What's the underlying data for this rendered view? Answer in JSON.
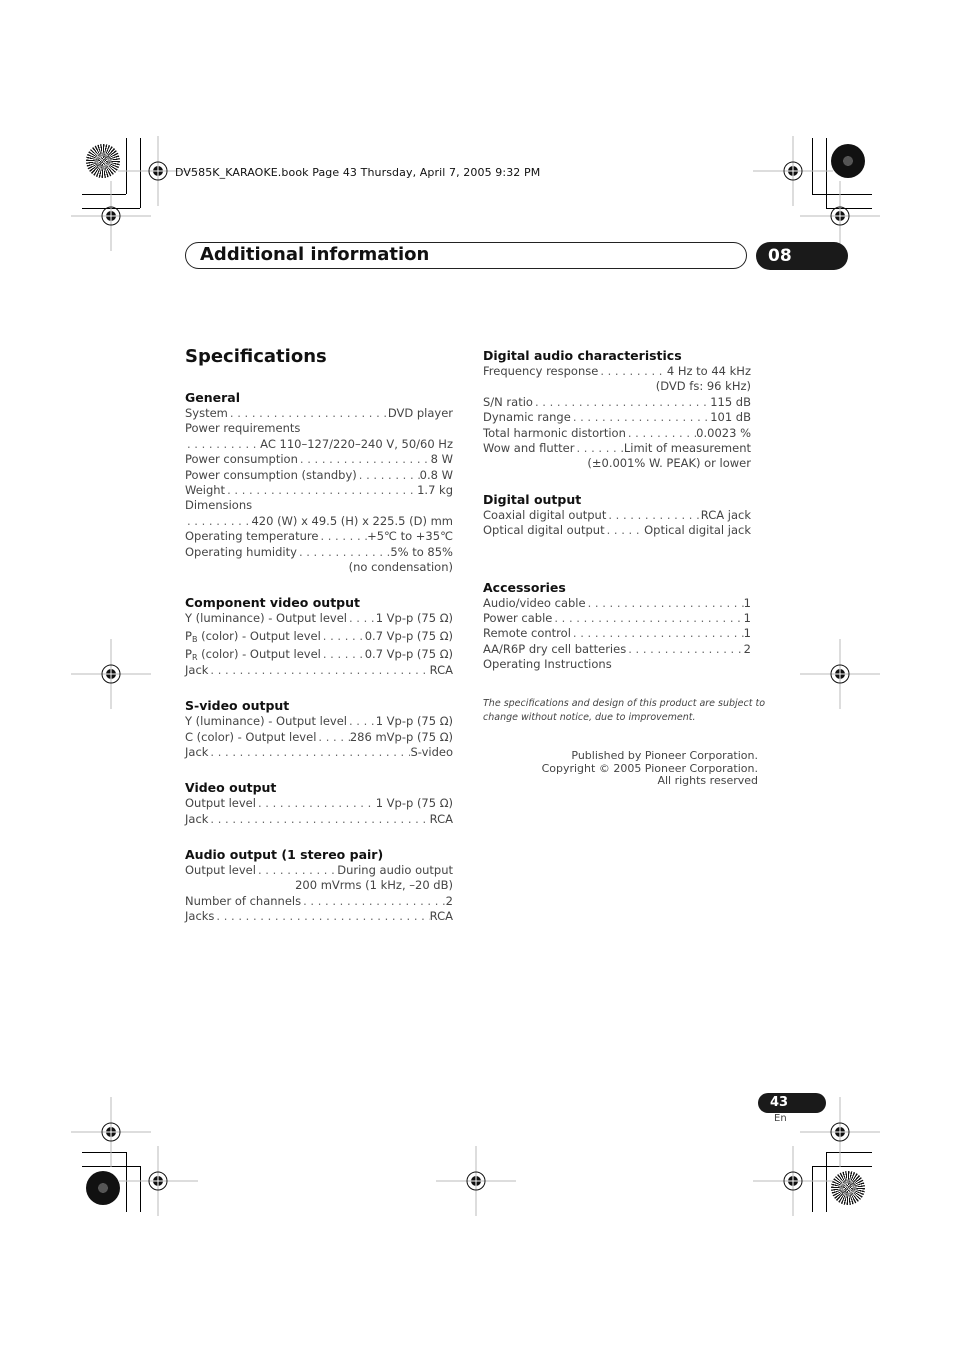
{
  "book_header": "DV585K_KARAOKE.book  Page 43  Thursday, April 7, 2005  9:32 PM",
  "section": {
    "title": "Additional information",
    "chapter": "08"
  },
  "page_title": "Specifications",
  "left_column": [
    {
      "heading": "General",
      "rows": [
        {
          "label": "System",
          "value": "DVD player"
        },
        {
          "label": "Power requirements",
          "value": "",
          "continuation": "AC 110–127/220–240 V, 50/60 Hz",
          "cont_dots": true
        },
        {
          "label": "Power consumption",
          "value": "8 W"
        },
        {
          "label": "Power consumption (standby)",
          "value": "0.8 W"
        },
        {
          "label": "Weight",
          "value": "1.7 kg"
        },
        {
          "label": "Dimensions",
          "value": "",
          "continuation": "420 (W) x 49.5 (H) x 225.5 (D) mm",
          "cont_dots": true
        },
        {
          "label": "Operating temperature",
          "value": "+5℃ to +35℃"
        },
        {
          "label": "Operating humidity",
          "value": "5% to 85%",
          "continuation": "(no condensation)"
        }
      ]
    },
    {
      "heading": "Component video output",
      "rows": [
        {
          "label": "Y (luminance) - Output level",
          "value": "1 Vp-p (75 Ω)"
        },
        {
          "label": "P_B (color) - Output level",
          "value": "0.7 Vp-p (75 Ω)"
        },
        {
          "label": "P_R (color) - Output level",
          "value": "0.7 Vp-p (75 Ω)"
        },
        {
          "label": "Jack",
          "value": "RCA"
        }
      ]
    },
    {
      "heading": "S-video output",
      "rows": [
        {
          "label": "Y (luminance) - Output level",
          "value": "1 Vp-p (75 Ω)"
        },
        {
          "label": "C (color) - Output level",
          "value": "286 mVp-p (75 Ω)"
        },
        {
          "label": "Jack",
          "value": "S-video"
        }
      ]
    },
    {
      "heading": "Video output",
      "rows": [
        {
          "label": "Output level",
          "value": "1 Vp-p (75 Ω)"
        },
        {
          "label": "Jack",
          "value": "RCA"
        }
      ]
    },
    {
      "heading": "Audio output (1 stereo pair)",
      "rows": [
        {
          "label": "Output level",
          "value": "During audio output",
          "continuation": "200 mVrms (1 kHz, –20 dB)"
        },
        {
          "label": "Number of channels",
          "value": "2"
        },
        {
          "label": "Jacks",
          "value": "RCA"
        }
      ]
    }
  ],
  "right_column": [
    {
      "heading": "Digital audio characteristics",
      "rows": [
        {
          "label": "Frequency response",
          "value": "4 Hz to 44 kHz",
          "continuation": "(DVD fs: 96 kHz)"
        },
        {
          "label": "S/N ratio",
          "value": "115 dB"
        },
        {
          "label": "Dynamic range",
          "value": "101 dB"
        },
        {
          "label": "Total harmonic distortion",
          "value": "0.0023 %"
        },
        {
          "label": "Wow and flutter",
          "value": "Limit of measurement",
          "continuation": "(±0.001% W. PEAK) or lower"
        }
      ]
    },
    {
      "heading": "Digital output",
      "rows": [
        {
          "label": "Coaxial digital output",
          "value": "RCA jack"
        },
        {
          "label": "Optical digital output",
          "value": "Optical digital jack"
        }
      ]
    },
    {
      "heading": "Accessories",
      "rows": [
        {
          "label": "Audio/video cable",
          "value": "1"
        },
        {
          "label": "Power cable",
          "value": "1"
        },
        {
          "label": "Remote control",
          "value": "1"
        },
        {
          "label": "AA/R6P dry cell batteries",
          "value": "2"
        },
        {
          "label": "Operating Instructions",
          "value": ""
        }
      ]
    }
  ],
  "note": "The specifications and design of this product are subject to change without notice, due to improvement.",
  "publisher": [
    "Published by Pioneer Corporation.",
    "Copyright © 2005 Pioneer Corporation.",
    "All rights reserved"
  ],
  "page_number": "43",
  "language": "En"
}
